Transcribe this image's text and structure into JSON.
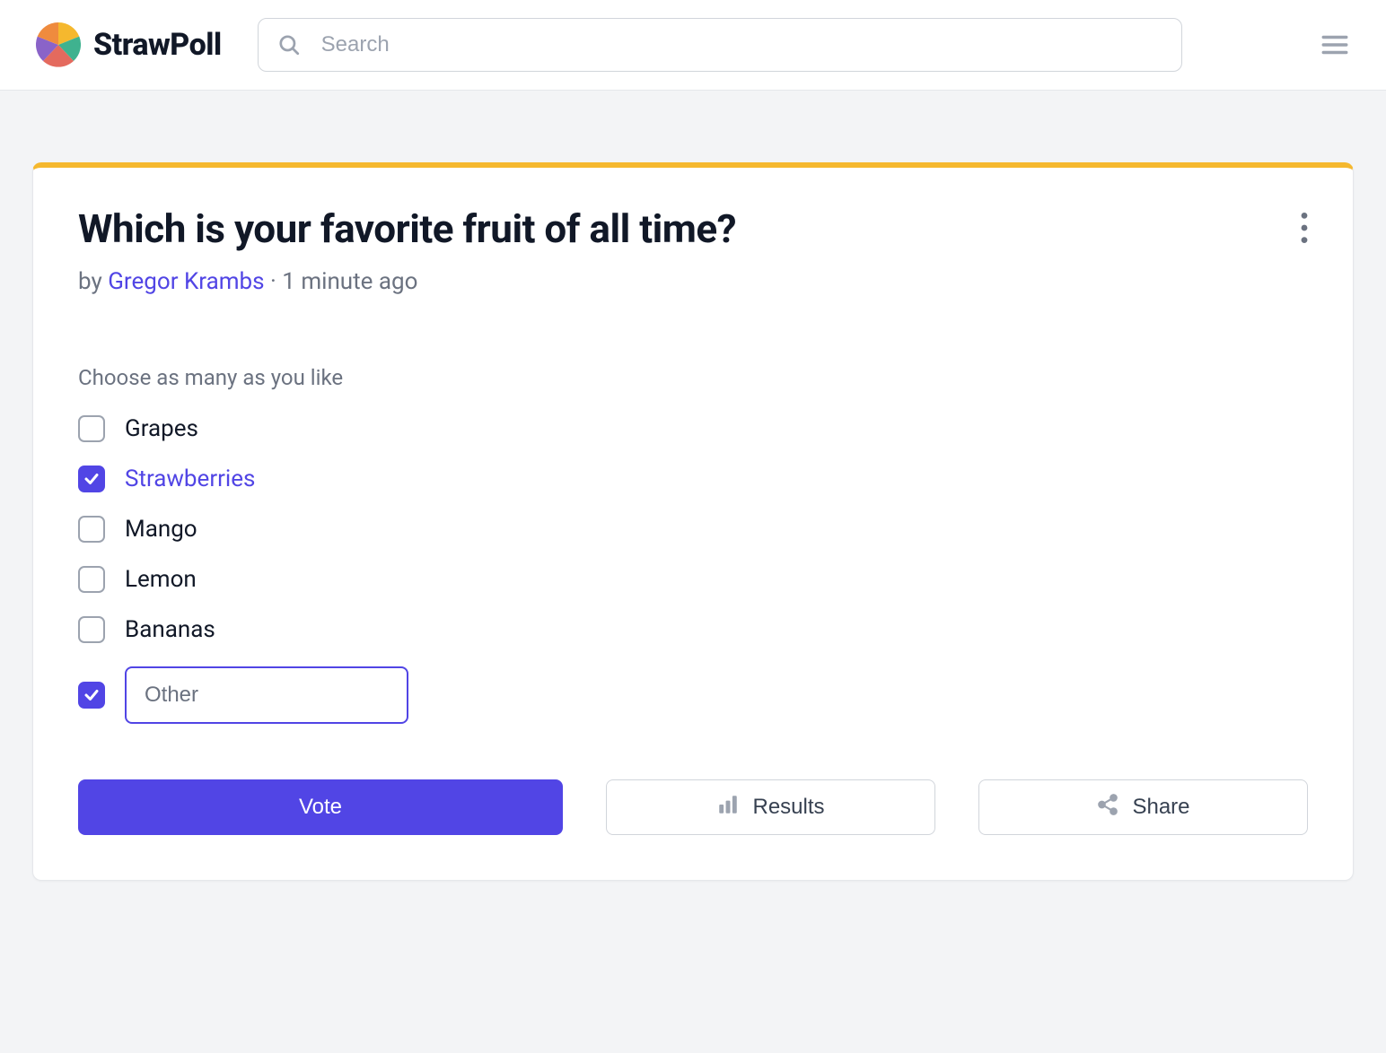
{
  "header": {
    "brand": "StrawPoll",
    "search_placeholder": "Search"
  },
  "poll": {
    "title": "Which is your favorite fruit of all time?",
    "byline_prefix": "by ",
    "author": "Gregor Krambs",
    "byline_suffix": " · 1 minute ago",
    "instruction": "Choose as many as you like",
    "options": [
      {
        "label": "Grapes",
        "checked": false
      },
      {
        "label": "Strawberries",
        "checked": true
      },
      {
        "label": "Mango",
        "checked": false
      },
      {
        "label": "Lemon",
        "checked": false
      },
      {
        "label": "Bananas",
        "checked": false
      }
    ],
    "other": {
      "checked": true,
      "placeholder": "Other",
      "value": ""
    },
    "buttons": {
      "vote": "Vote",
      "results": "Results",
      "share": "Share"
    }
  }
}
